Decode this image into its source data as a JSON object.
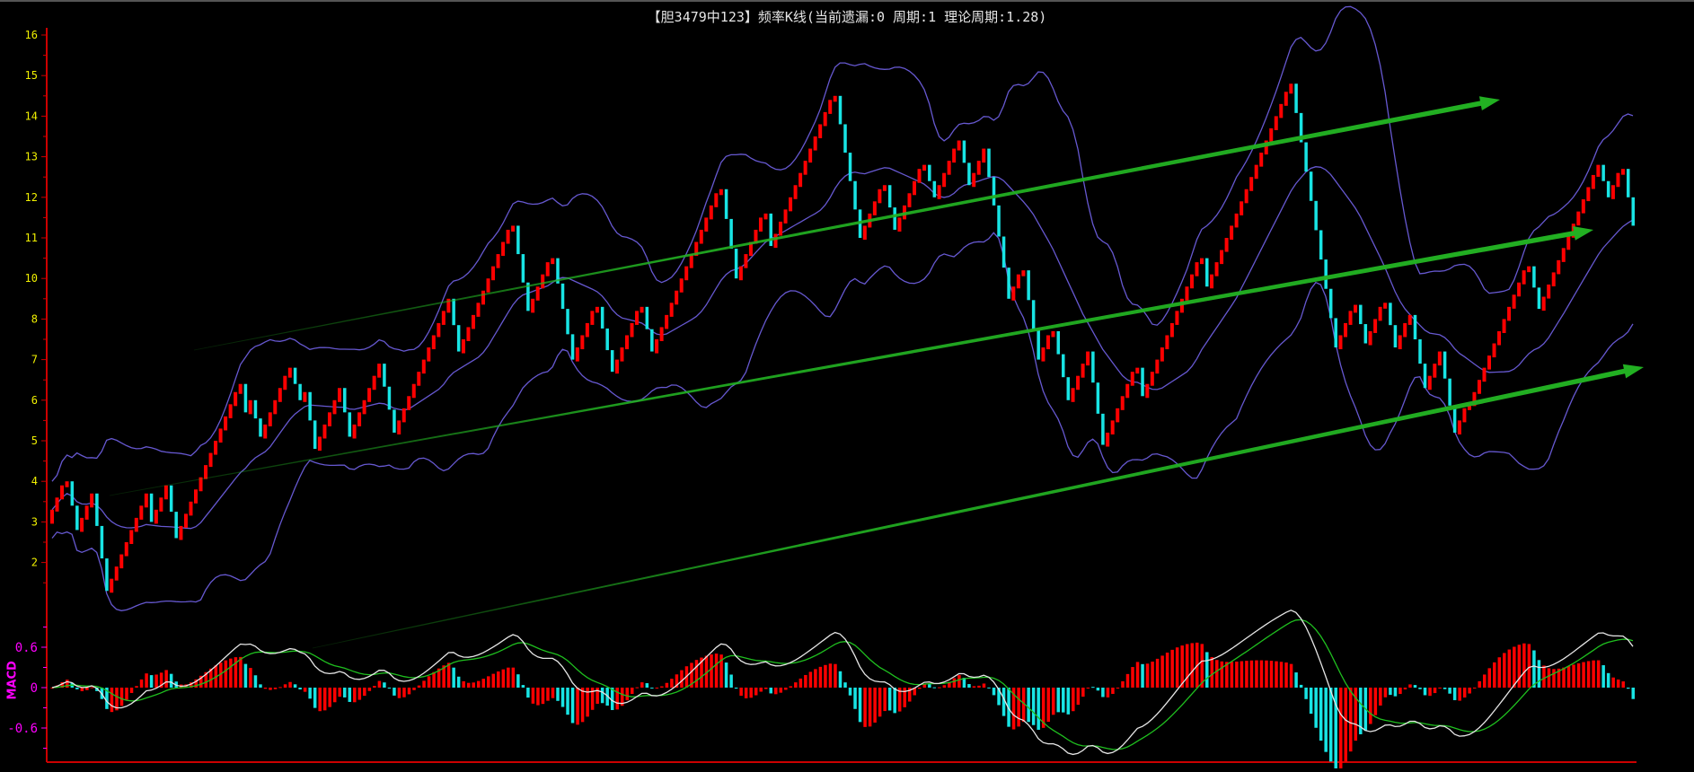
{
  "title": "【胆3479中123】频率K线(当前遗漏:0 周期:1 理论周期:1.28)",
  "colors": {
    "background": "#000000",
    "axis": "#cc0000",
    "up_bar": "#ff0000",
    "down_bar": "#18e4e4",
    "bands": "#6658d0",
    "dif_line": "#e6e6e6",
    "dea_line": "#1fbf1f",
    "trend_arrow": "#22b022",
    "price_ticks": "#f0f000",
    "macd_ticks": "#ff00ff"
  },
  "chart_data": {
    "type": "candlestick",
    "title": "【胆3479中123】频率K线(当前遗漏:0 周期:1 理论周期:1.28)",
    "y_ticks": [
      "16",
      "15",
      "14",
      "13",
      "12",
      "11",
      "10",
      "8",
      "7",
      "6",
      "5",
      "4",
      "3",
      "2"
    ],
    "price_waypoints": [
      3.0,
      4.0,
      2.8,
      3.7,
      1.3,
      3.7,
      3.0,
      3.9,
      2.6,
      6.4,
      5.7,
      6.0,
      5.1,
      6.8,
      6.0,
      6.2,
      4.8,
      6.3,
      5.1,
      6.9,
      5.2,
      9.0,
      7.2,
      11.3,
      8.4,
      10.5,
      7.0,
      8.6,
      6.7,
      8.6,
      7.2,
      12.2,
      10.0,
      11.6,
      10.8,
      14.5,
      11.0,
      12.3,
      11.2,
      12.8,
      12.0,
      13.4,
      12.3,
      13.2,
      11.8,
      9.0,
      10.2,
      7.0,
      7.7,
      6.0,
      7.2,
      4.9,
      6.8,
      6.1,
      10.5,
      9.6,
      14.8,
      7.3,
      8.7,
      7.4,
      8.8,
      7.3,
      8.2,
      6.3,
      7.2,
      5.2,
      5.9,
      10.3,
      8.5,
      12.8,
      12.0,
      12.7,
      11.3
    ],
    "overlays": {
      "bollinger": {
        "period": 20,
        "k": 2
      }
    },
    "macd": {
      "label": "MACD",
      "ticks": [
        "0.6",
        "0",
        "-0.6"
      ],
      "tick_values": [
        0.6,
        0,
        -0.6
      ],
      "ylim": [
        -1.2,
        1.2
      ],
      "fast": 12,
      "slow": 26,
      "signal": 9
    },
    "trend_arrows": 3
  }
}
